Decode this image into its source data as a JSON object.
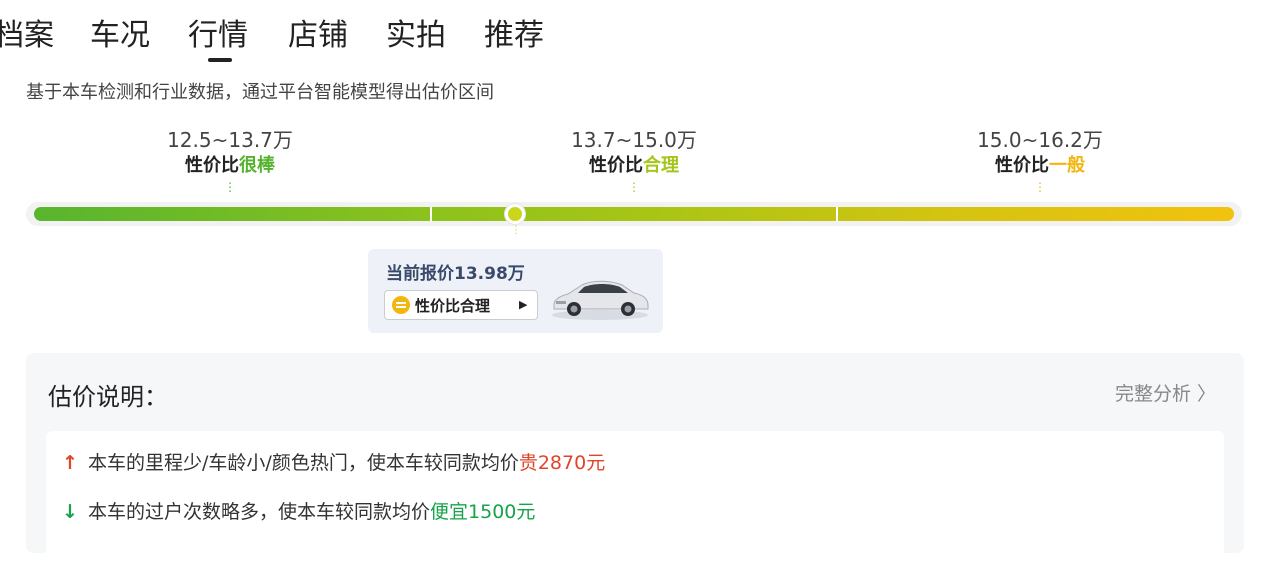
{
  "tabs": [
    {
      "label": "档案"
    },
    {
      "label": "车况"
    },
    {
      "label": "行情",
      "active": true
    },
    {
      "label": "店铺"
    },
    {
      "label": "实拍"
    },
    {
      "label": "推荐"
    }
  ],
  "subtitle": "基于本车检测和行业数据，通过平台智能模型得出估价区间",
  "ranges": [
    {
      "value": "12.5~13.7万",
      "label_prefix": "性价比",
      "label_grade": "很棒",
      "color": "#54b32d"
    },
    {
      "value": "13.7~15.0万",
      "label_prefix": "性价比",
      "label_grade": "合理",
      "color": "#a4c61a"
    },
    {
      "value": "15.0~16.2万",
      "label_prefix": "性价比",
      "label_grade": "一般",
      "color": "#f2b60f"
    }
  ],
  "current": {
    "price_text": "当前报价13.98万",
    "rating_label": "性价比合理",
    "rating_icon": "equals-circle-icon",
    "car_image_icon": "sedan-car-icon"
  },
  "explanation": {
    "title": "估价说明：",
    "full_analysis": "完整分析",
    "reasons": [
      {
        "direction": "up",
        "prefix": "本车的",
        "factors": "里程少/车龄小/颜色热门",
        "middle": "，使本车较同款均价",
        "effect": "贵2870元",
        "color": "#e0452b"
      },
      {
        "direction": "down",
        "prefix": "本车的",
        "factors": "过户次数略多",
        "middle": "，使本车较同款均价",
        "effect": "便宜1500元",
        "color": "#17a34a"
      }
    ]
  }
}
